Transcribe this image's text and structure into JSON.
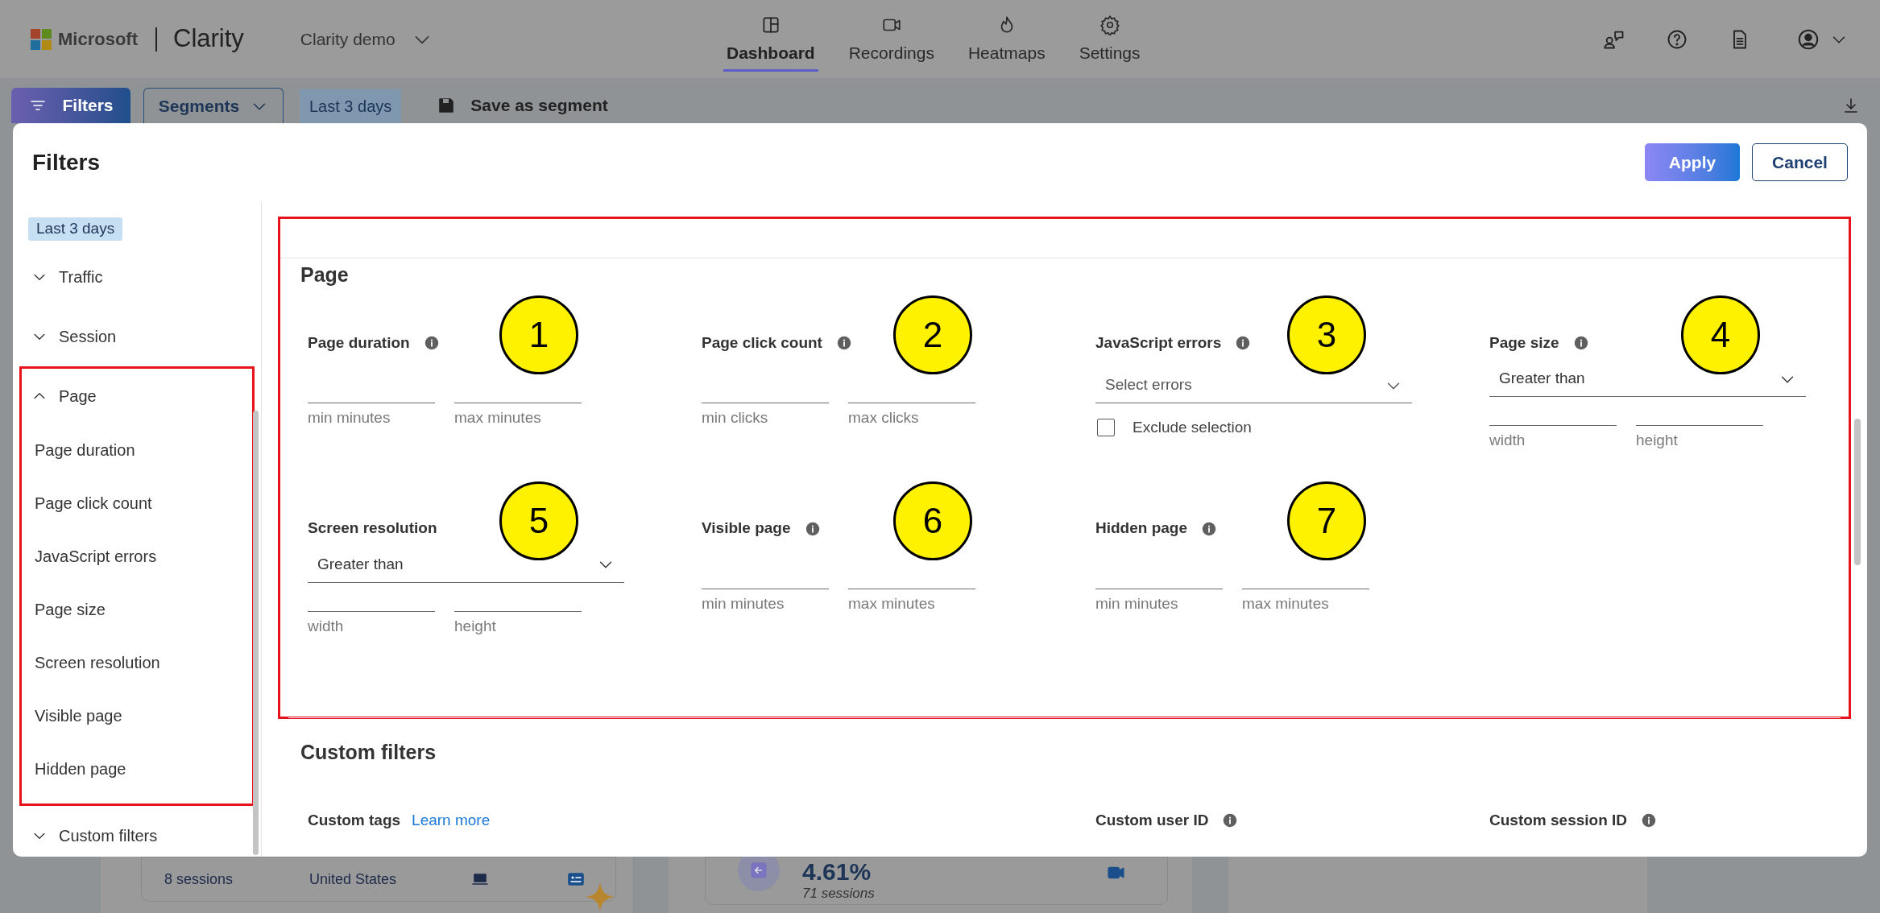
{
  "header": {
    "brand": "Microsoft",
    "product": "Clarity",
    "project": "Clarity demo"
  },
  "nav": [
    {
      "label": "Dashboard",
      "selected": true
    },
    {
      "label": "Recordings",
      "selected": false
    },
    {
      "label": "Heatmaps",
      "selected": false
    },
    {
      "label": "Settings",
      "selected": false
    }
  ],
  "toolbar": {
    "filters": "Filters",
    "segments": "Segments",
    "date": "Last 3 days",
    "save": "Save as segment"
  },
  "dialog": {
    "title": "Filters",
    "apply": "Apply",
    "cancel": "Cancel",
    "date_chip": "Last 3 days",
    "sidebar": [
      {
        "label": "Traffic",
        "expanded": false,
        "highlight": false
      },
      {
        "label": "Session",
        "expanded": false,
        "highlight": false
      },
      {
        "label": "Page",
        "expanded": true,
        "highlight": true,
        "children": [
          {
            "label": "Page duration"
          },
          {
            "label": "Page click count"
          },
          {
            "label": "JavaScript errors"
          },
          {
            "label": "Page size"
          },
          {
            "label": "Screen resolution"
          },
          {
            "label": "Visible page"
          },
          {
            "label": "Hidden page"
          }
        ]
      },
      {
        "label": "Custom filters",
        "expanded": false,
        "highlight": false
      }
    ],
    "sections": [
      {
        "title": "Page",
        "highlight": true,
        "fields": [
          {
            "kind": "range",
            "label": "Page duration",
            "info": true,
            "marker": "1",
            "inputs": [
              "min minutes",
              "max minutes"
            ]
          },
          {
            "kind": "range",
            "label": "Page click count",
            "info": true,
            "marker": "2",
            "inputs": [
              "min clicks",
              "max clicks"
            ]
          },
          {
            "kind": "select",
            "label": "JavaScript errors",
            "info": true,
            "marker": "3",
            "placeholder": "Select errors",
            "checkbox": {
              "label": "Exclude selection",
              "checked": false
            }
          },
          {
            "kind": "size",
            "label": "Page size",
            "info": true,
            "marker": "4",
            "value": "Greater than",
            "inputs": [
              "width",
              "height"
            ]
          },
          {
            "kind": "size",
            "label": "Screen resolution",
            "info": false,
            "marker": "5",
            "value": "Greater than",
            "inputs": [
              "width",
              "height"
            ]
          },
          {
            "kind": "range",
            "label": "Visible page",
            "info": true,
            "marker": "6",
            "inputs": [
              "min minutes",
              "max minutes"
            ]
          },
          {
            "kind": "range",
            "label": "Hidden page",
            "info": true,
            "marker": "7",
            "inputs": [
              "min minutes",
              "max minutes"
            ]
          }
        ]
      },
      {
        "title": "Custom filters",
        "highlight": false,
        "fields": [
          {
            "kind": "tags",
            "label": "Custom tags",
            "link": "Learn more"
          },
          {
            "kind": "empty"
          },
          {
            "kind": "heading",
            "label": "Custom user ID",
            "info": true
          },
          {
            "kind": "heading",
            "label": "Custom session ID",
            "info": true
          }
        ]
      }
    ]
  },
  "background": {
    "sessions": "8 sessions",
    "country": "United States",
    "rate": "4.61%",
    "rate_sessions": "71 sessions"
  }
}
